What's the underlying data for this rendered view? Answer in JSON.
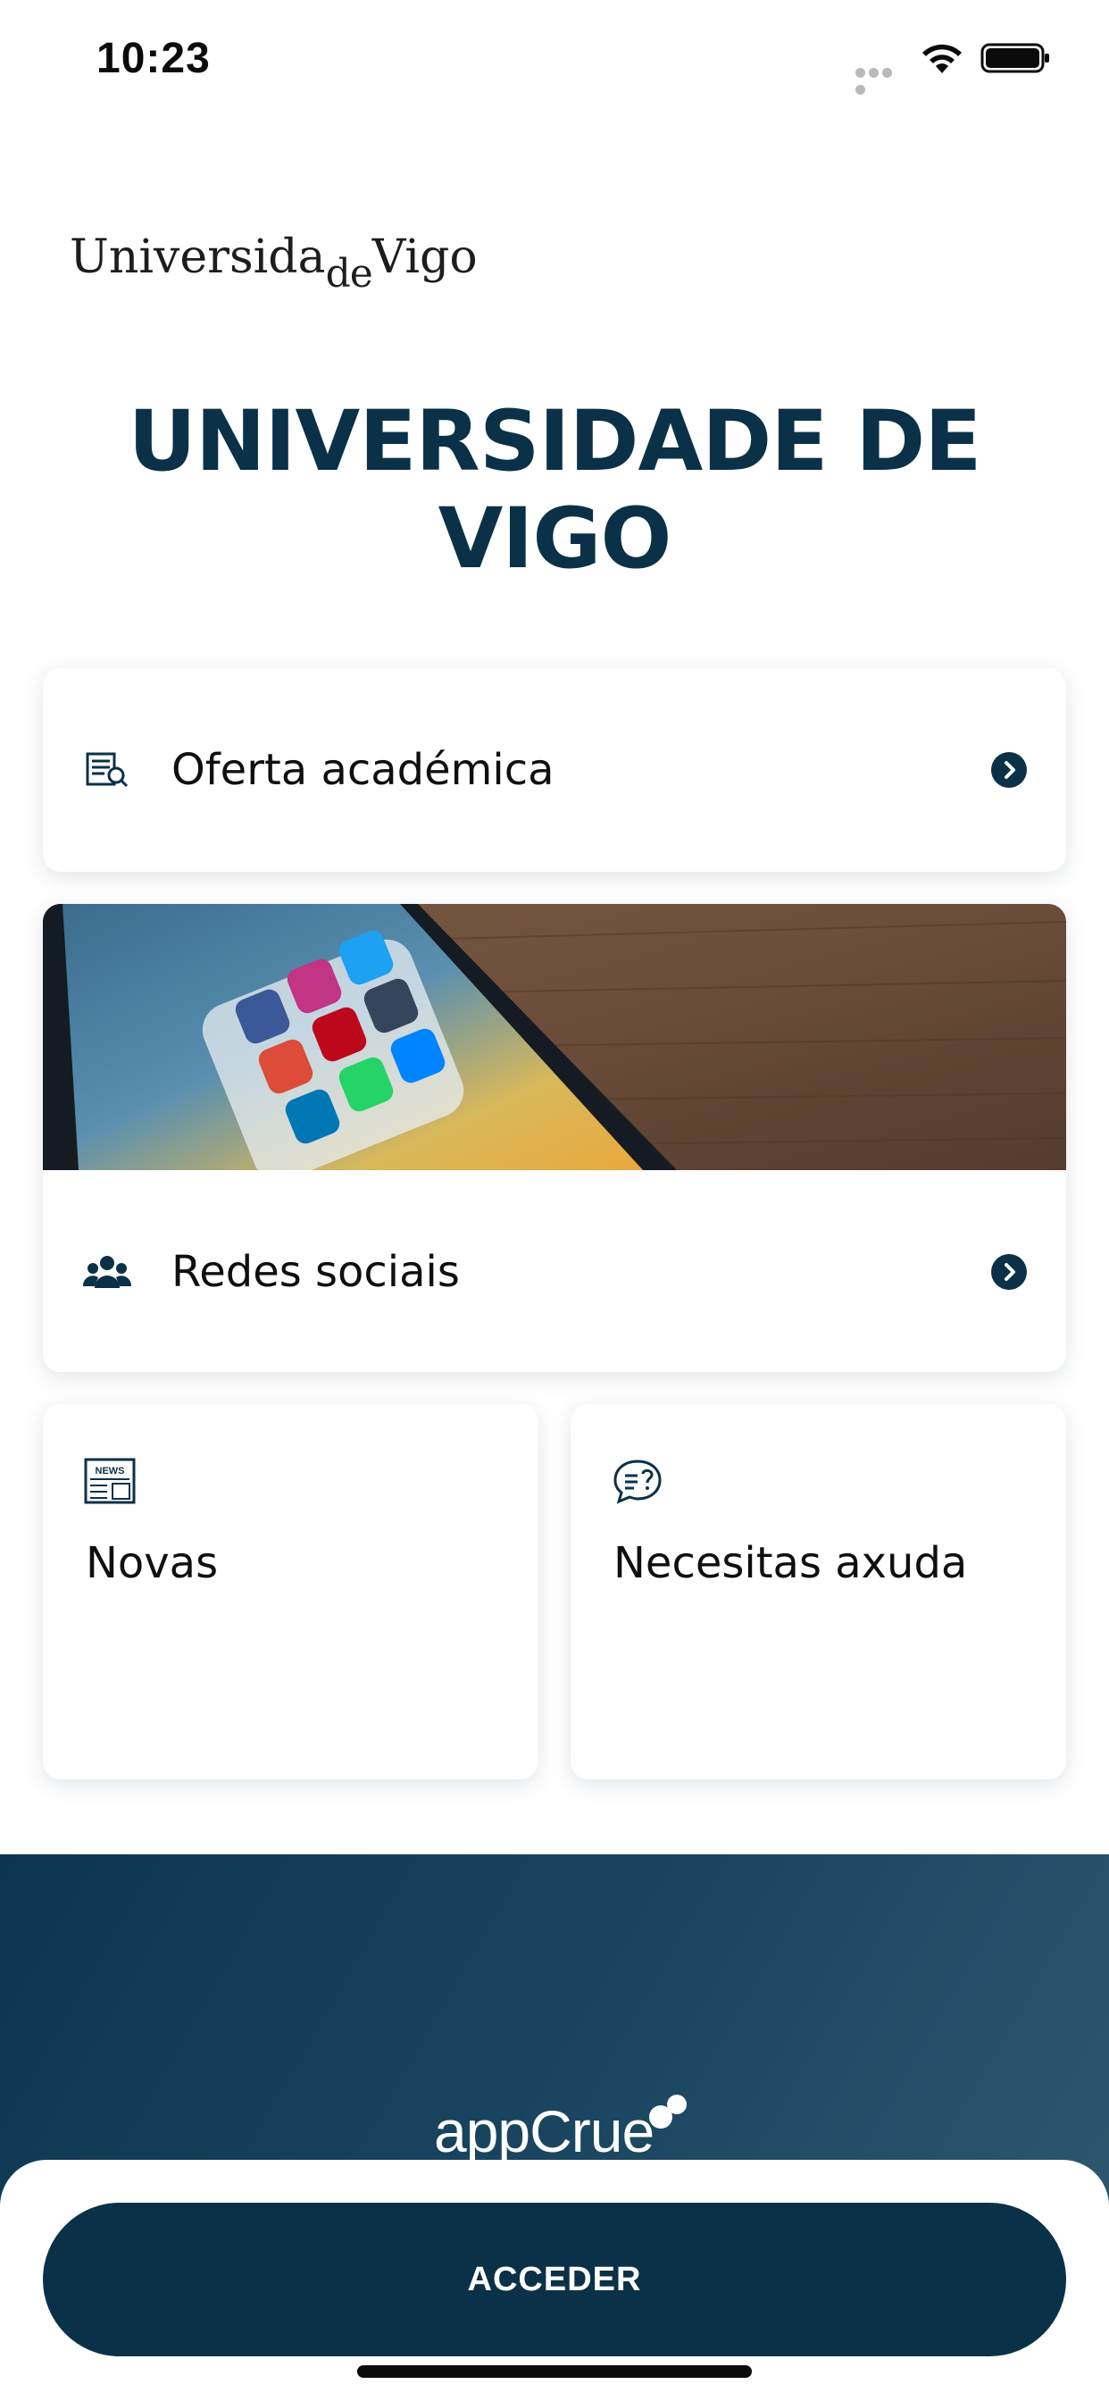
{
  "status_bar": {
    "time": "10:23"
  },
  "logo": {
    "part1": "Universida",
    "part2": "de",
    "part3": "Vigo"
  },
  "title": "UNIVERSIDADE DE VIGO",
  "cards": {
    "oferta": {
      "label": "Oferta académica",
      "icon": "catalog-search-icon"
    },
    "redes": {
      "label": "Redes sociais",
      "icon": "users-group-icon",
      "image": "phone-social-apps-photo"
    },
    "novas": {
      "label": "Novas",
      "icon": "newspaper-icon"
    },
    "axuda": {
      "label": "Necesitas axuda",
      "icon": "help-chat-icon"
    }
  },
  "footer": {
    "brand": "appCrue"
  },
  "access_button": "ACCEDER",
  "colors": {
    "primary": "#0a3148",
    "card_bg": "#ffffff",
    "footer_gradient_start": "#0d3550",
    "footer_gradient_end": "#305a70"
  }
}
